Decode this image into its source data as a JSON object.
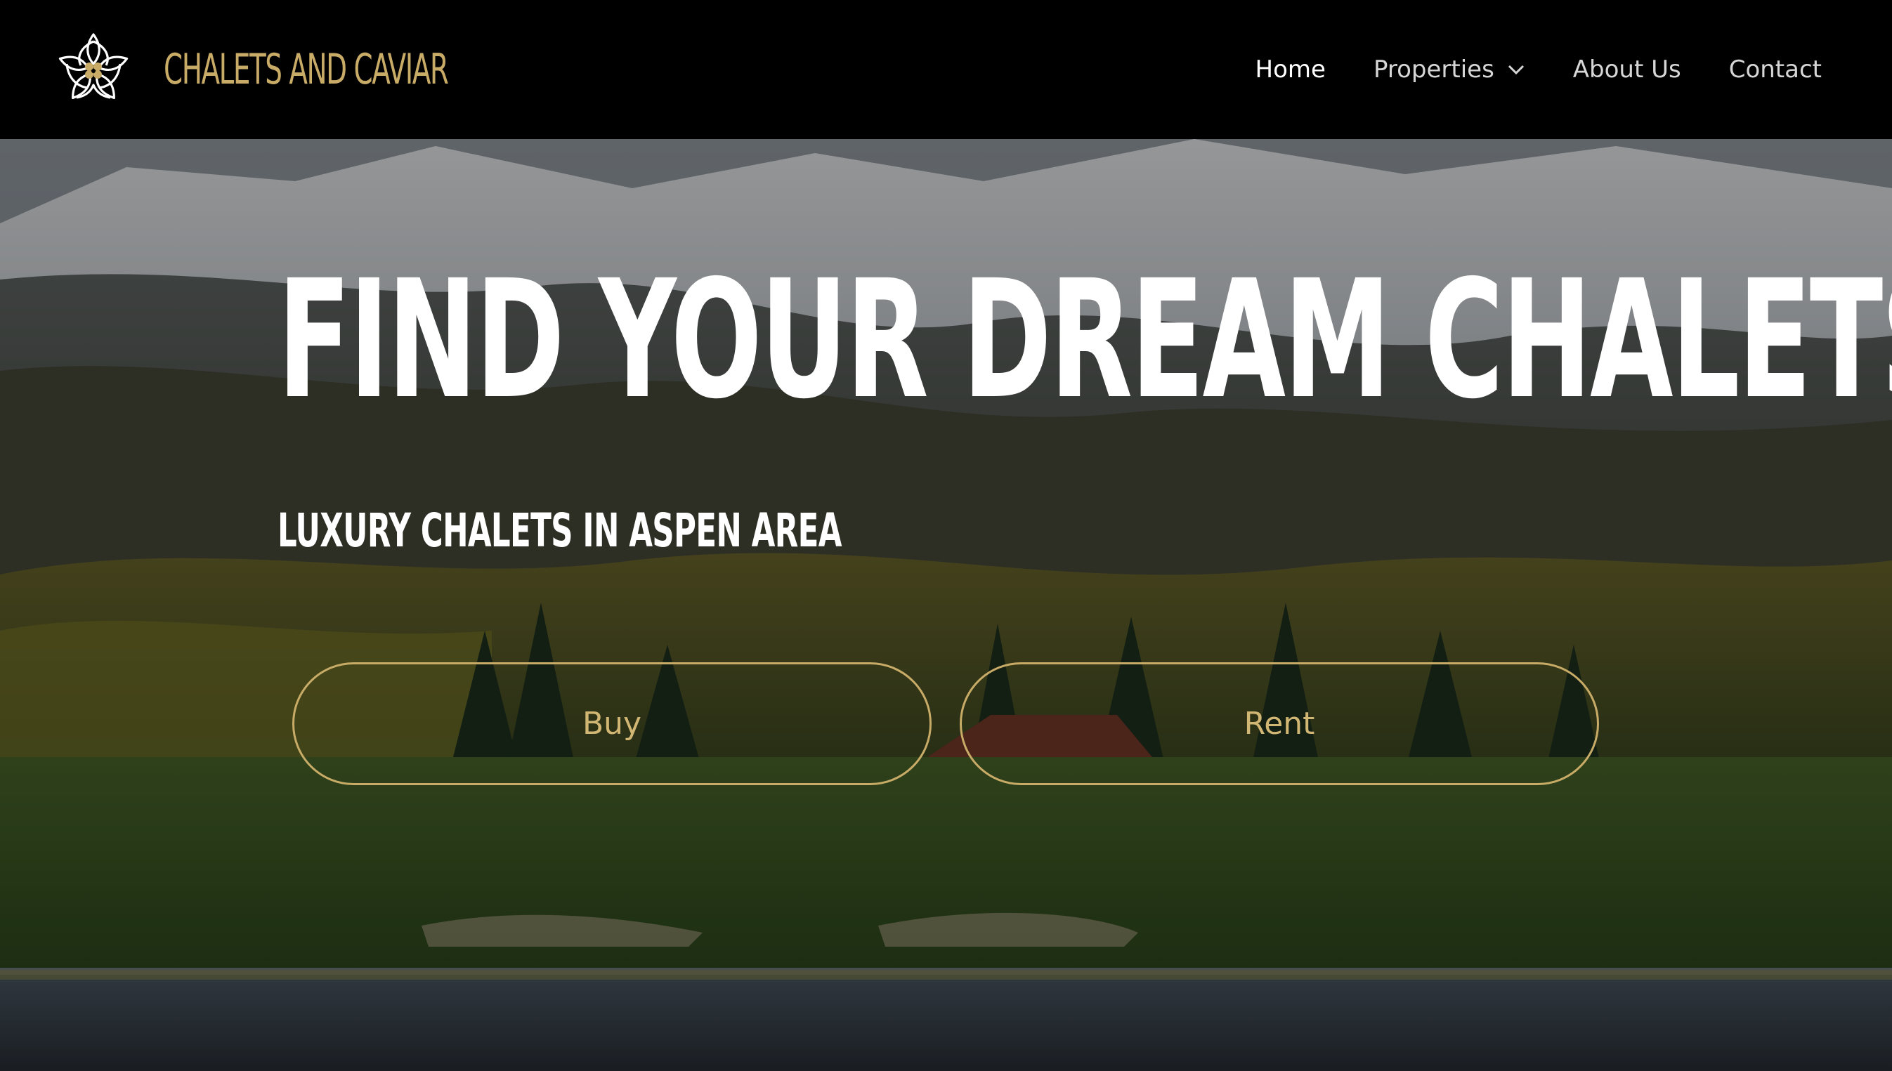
{
  "brand": {
    "name": "CHALETS AND CAVIAR",
    "color": "#c8ab67"
  },
  "nav": {
    "items": [
      {
        "label": "Home",
        "active": true
      },
      {
        "label": "Properties",
        "has_dropdown": true
      },
      {
        "label": "About Us"
      },
      {
        "label": "Contact"
      }
    ]
  },
  "hero": {
    "title": "FIND YOUR DREAM CHALETS",
    "subtitle": "LUXURY CHALETS IN ASPEN AREA",
    "buttons": {
      "buy": "Buy",
      "rent": "Rent"
    },
    "accent": "#c8ab67"
  },
  "icons": [
    "lotus-logo-icon",
    "chevron-down-icon"
  ]
}
